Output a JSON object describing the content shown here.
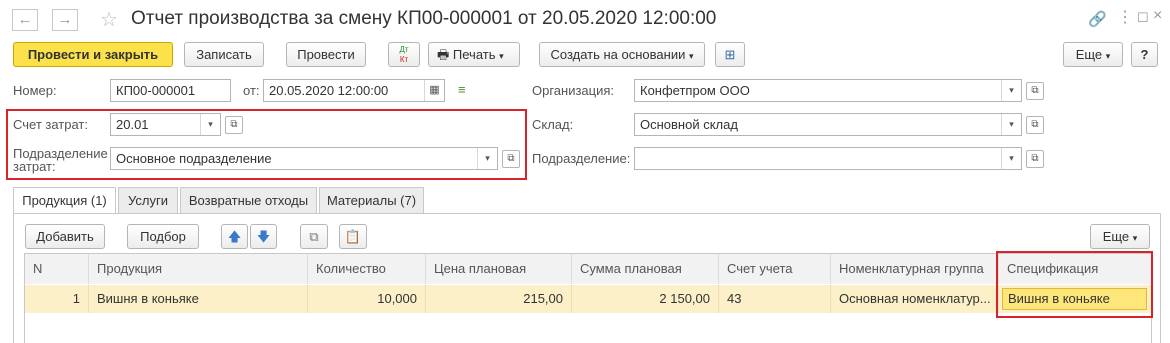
{
  "window": {
    "title": "Отчет производства за смену КП00-000001 от 20.05.2020 12:00:00"
  },
  "toolbar": {
    "post_close": "Провести и закрыть",
    "save": "Записать",
    "post": "Провести",
    "dtkt_top": "Дт",
    "dtkt_bottom": "Кт",
    "print": "Печать",
    "create_based": "Создать на основании",
    "more": "Еще",
    "help": "?"
  },
  "form": {
    "number_label": "Номер:",
    "number_value": "КП00-000001",
    "date_label": "от:",
    "date_value": "20.05.2020 12:00:00",
    "org_label": "Организация:",
    "org_value": "Конфетпром ООО",
    "cost_account_label": "Счет затрат:",
    "cost_account_value": "20.01",
    "warehouse_label": "Склад:",
    "warehouse_value": "Основной склад",
    "cost_dept_label_1": "Подразделение",
    "cost_dept_label_2": "затрат:",
    "cost_dept_value": "Основное подразделение",
    "dept_label": "Подразделение:",
    "dept_value": ""
  },
  "tabs": [
    {
      "label": "Продукция (1)"
    },
    {
      "label": "Услуги"
    },
    {
      "label": "Возвратные отходы"
    },
    {
      "label": "Материалы (7)"
    }
  ],
  "table_toolbar": {
    "add": "Добавить",
    "pick": "Подбор",
    "more": "Еще"
  },
  "table": {
    "headers": [
      "N",
      "Продукция",
      "Количество",
      "Цена плановая",
      "Сумма плановая",
      "Счет учета",
      "Номенклатурная группа",
      "Спецификация"
    ],
    "rows": [
      [
        "1",
        "Вишня в коньяке",
        "10,000",
        "215,00",
        "2 150,00",
        "43",
        "Основная номенклатур...",
        "Вишня в коньяке"
      ]
    ]
  }
}
